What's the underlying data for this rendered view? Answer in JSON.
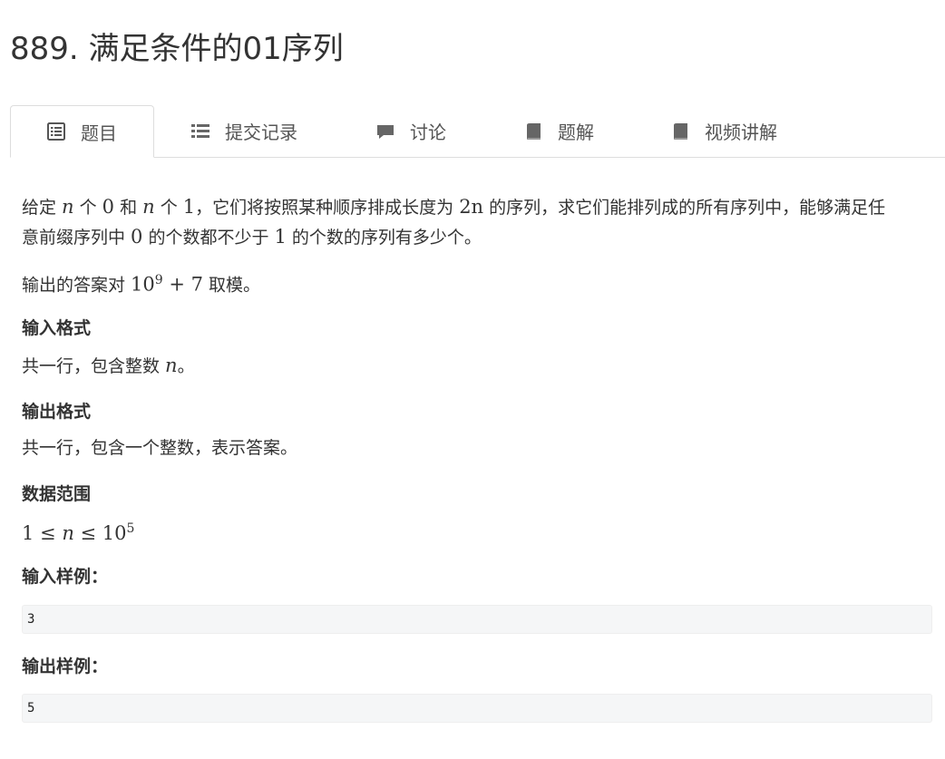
{
  "problem": {
    "title": "889. 满足条件的01序列"
  },
  "tabs": [
    {
      "label": "题目",
      "icon": "list-alt-icon"
    },
    {
      "label": "提交记录",
      "icon": "list-icon"
    },
    {
      "label": "讨论",
      "icon": "comment-icon"
    },
    {
      "label": "题解",
      "icon": "book-icon"
    },
    {
      "label": "视频讲解",
      "icon": "book-icon"
    }
  ],
  "statement": {
    "line1_a": "给定 ",
    "n": "n",
    "line1_b": " 个 ",
    "zero": "0",
    "line1_c": " 和 ",
    "line1_d": " 个 ",
    "one": "1",
    "line1_e": "，它们将按照某种顺序排成长度为 ",
    "two_n": "2n",
    "line1_f": " 的序列，求它们能排列成的所有序列中，能够满足任",
    "line2_a": "意前缀序列中 ",
    "line2_b": " 的个数都不少于 ",
    "line2_c": " 的个数的序列有多少个。",
    "mod_a": "输出的答案对 ",
    "mod_base": "10",
    "mod_exp": "9",
    "mod_plus": " + 7",
    "mod_b": " 取模。"
  },
  "input_format": {
    "heading": "输入格式",
    "text_a": "共一行，包含整数 ",
    "text_b": "。"
  },
  "output_format": {
    "heading": "输出格式",
    "text": "共一行，包含一个整数，表示答案。"
  },
  "range": {
    "heading": "数据范围",
    "expr_a": "1 ≤ ",
    "expr_b": " ≤ 10",
    "expr_exp": "5"
  },
  "sample_input": {
    "heading": "输入样例：",
    "value": "3"
  },
  "sample_output": {
    "heading": "输出样例：",
    "value": "5"
  }
}
